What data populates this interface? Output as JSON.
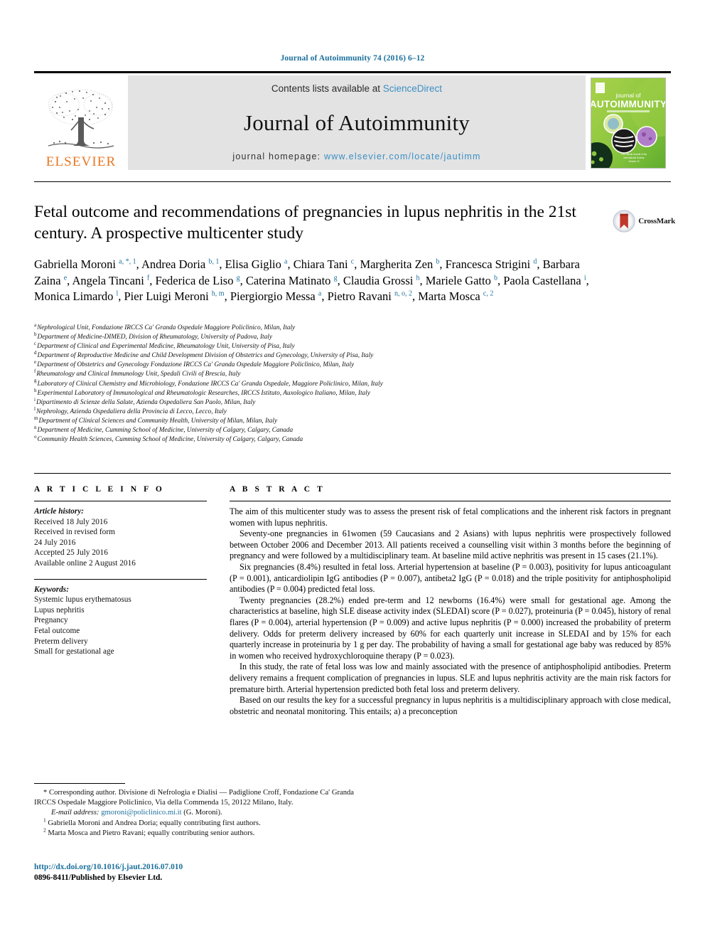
{
  "running_head": "Journal of Autoimmunity 74 (2016) 6–12",
  "masthead": {
    "publisher_logo_label": "ELSEVIER",
    "contents_prefix": "Contents lists available at",
    "contents_link": "ScienceDirect",
    "journal_name": "Journal of Autoimmunity",
    "homepage_prefix": "journal homepage:",
    "homepage_url": "www.elsevier.com/locate/jautimm",
    "cover": {
      "line1": "journal of",
      "line2": "AUTOIMMUNITY",
      "tagline": "OFFICIAL JOURNAL OF THE INTERNATIONAL SOCIETY"
    },
    "colors": {
      "band_bg": "#e3e3e3",
      "link_blue": "#3c8fc4",
      "elsevier_orange": "#e87722",
      "cover_green": "#8cc63f"
    }
  },
  "article": {
    "title": "Fetal outcome and recommendations of pregnancies in lupus nephritis in the 21st century. A prospective multicenter study",
    "crossmark_label": "CrossMark",
    "authors": [
      {
        "name": "Gabriella Moroni",
        "sup": "a, *, 1"
      },
      {
        "name": "Andrea Doria",
        "sup": "b, 1"
      },
      {
        "name": "Elisa Giglio",
        "sup": "a"
      },
      {
        "name": "Chiara Tani",
        "sup": "c"
      },
      {
        "name": "Margherita Zen",
        "sup": "b"
      },
      {
        "name": "Francesca Strigini",
        "sup": "d"
      },
      {
        "name": "Barbara Zaina",
        "sup": "e"
      },
      {
        "name": "Angela Tincani",
        "sup": "f"
      },
      {
        "name": "Federica de Liso",
        "sup": "g"
      },
      {
        "name": "Caterina Matinato",
        "sup": "g"
      },
      {
        "name": "Claudia Grossi",
        "sup": "h"
      },
      {
        "name": "Mariele Gatto",
        "sup": "b"
      },
      {
        "name": "Paola Castellana",
        "sup": "i"
      },
      {
        "name": "Monica Limardo",
        "sup": "l"
      },
      {
        "name": "Pier Luigi Meroni",
        "sup": "h, m"
      },
      {
        "name": "Piergiorgio Messa",
        "sup": "a"
      },
      {
        "name": "Pietro Ravani",
        "sup": "n, o, 2"
      },
      {
        "name": "Marta Mosca",
        "sup": "c, 2"
      }
    ],
    "affiliations": [
      {
        "key": "a",
        "text": "Nephrological Unit, Fondazione IRCCS Ca' Granda Ospedale Maggiore Policlinico, Milan, Italy"
      },
      {
        "key": "b",
        "text": "Department of Medicine-DIMED, Division of Rheumatology, University of Padova, Italy"
      },
      {
        "key": "c",
        "text": "Department of Clinical and Experimental Medicine, Rheumatology Unit, University of Pisa, Italy"
      },
      {
        "key": "d",
        "text": "Department of Reproductive Medicine and Child Development Division of Obstetrics and Gynecology, University of Pisa, Italy"
      },
      {
        "key": "e",
        "text": "Department of Obstetrics and Gynecology Fondazione IRCCS Ca' Granda Ospedale Maggiore Policlinico, Milan, Italy"
      },
      {
        "key": "f",
        "text": "Rheumatology and Clinical Immunology Unit, Spedali Civili of Brescia, Italy"
      },
      {
        "key": "g",
        "text": "Laboratory of Clinical Chemistry and Microbiology, Fondazione IRCCS Ca' Granda Ospedale, Maggiore Policlinico, Milan, Italy"
      },
      {
        "key": "h",
        "text": "Experimental Laboratory of Immunological and Rheumatologic Researches, IRCCS Istituto, Auxologico Italiano, Milan, Italy"
      },
      {
        "key": "i",
        "text": "Dipartimento di Scienze della Salute, Azienda Ospedaliera San Paolo, Milan, Italy"
      },
      {
        "key": "l",
        "text": "Nephrology, Azienda Ospedaliera della Provincia di Lecco, Lecco, Italy"
      },
      {
        "key": "m",
        "text": "Department of Clinical Sciences and Community Health, University of Milan, Milan, Italy"
      },
      {
        "key": "n",
        "text": "Department of Medicine, Cumming School of Medicine, University of Calgary, Calgary, Canada"
      },
      {
        "key": "o",
        "text": "Community Health Sciences, Cumming School of Medicine, University of Calgary, Calgary, Canada"
      }
    ]
  },
  "article_info": {
    "heading": "A R T I C L E  I N F O",
    "history_label": "Article history:",
    "history": [
      "Received 18 July 2016",
      "Received in revised form",
      "24 July 2016",
      "Accepted 25 July 2016",
      "Available online 2 August 2016"
    ],
    "keywords_label": "Keywords:",
    "keywords": [
      "Systemic lupus erythematosus",
      "Lupus nephritis",
      "Pregnancy",
      "Fetal outcome",
      "Preterm delivery",
      "Small for gestational age"
    ]
  },
  "abstract": {
    "heading": "A B S T R A C T",
    "paragraphs": [
      "The aim of this multicenter study was to assess the present risk of fetal complications and the inherent risk factors in pregnant women with lupus nephritis.",
      "Seventy-one pregnancies in 61women (59 Caucasians and 2 Asians) with lupus nephritis were prospectively followed between October 2006 and December 2013. All patients received a counselling visit within 3 months before the beginning of pregnancy and were followed by a multidisciplinary team. At baseline mild active nephritis was present in 15 cases (21.1%).",
      "Six pregnancies (8.4%) resulted in fetal loss. Arterial hypertension at baseline (P = 0.003), positivity for lupus anticoagulant (P = 0.001), anticardiolipin IgG antibodies (P = 0.007), antibeta2 IgG (P = 0.018) and the triple positivity for antiphospholipid antibodies (P = 0.004) predicted fetal loss.",
      "Twenty pregnancies (28.2%) ended pre-term and 12 newborns (16.4%) were small for gestational age. Among the characteristics at baseline, high SLE disease activity index (SLEDAI) score (P = 0.027), proteinuria (P = 0.045), history of renal flares (P = 0.004), arterial hypertension (P = 0.009) and active lupus nephritis (P = 0.000) increased the probability of preterm delivery. Odds for preterm delivery increased by 60% for each quarterly unit increase in SLEDAI and by 15% for each quarterly increase in proteinuria by 1 g per day. The probability of having a small for gestational age baby was reduced by 85% in women who received hydroxychloroquine therapy (P = 0.023).",
      "In this study, the rate of fetal loss was low and mainly associated with the presence of antiphospholipid antibodies. Preterm delivery remains a frequent complication of pregnancies in lupus. SLE and lupus nephritis activity are the main risk factors for premature birth. Arterial hypertension predicted both fetal loss and preterm delivery.",
      "Based on our results the key for a successful pregnancy in lupus nephritis is a multidisciplinary approach with close medical, obstetric and neonatal monitoring. This entails; a) a preconception"
    ]
  },
  "footnotes": {
    "corresponding": "* Corresponding author. Divisione di Nefrologia e Dialisi — Padiglione Croff, Fondazione Ca' Granda IRCCS Ospedale Maggiore Policlinico, Via della Commenda 15, 20122 Milano, Italy.",
    "email_label": "E-mail address:",
    "email": "gmoroni@policlinico.mi.it",
    "email_owner": "(G. Moroni).",
    "note1_sup": "1",
    "note1": "Gabriella Moroni and Andrea Doria; equally contributing first authors.",
    "note2_sup": "2",
    "note2": "Marta Mosca and Pietro Ravani; equally contributing senior authors.",
    "doi": "http://dx.doi.org/10.1016/j.jaut.2016.07.010",
    "copyright": "0896-8411/Published by Elsevier Ltd."
  }
}
